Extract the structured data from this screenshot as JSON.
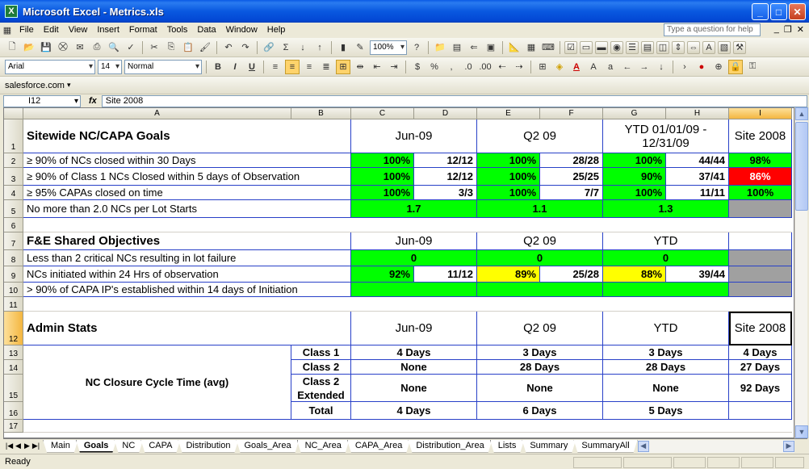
{
  "window": {
    "title": "Microsoft Excel - Metrics.xls",
    "app_glyph": "X"
  },
  "menu": [
    "File",
    "Edit",
    "View",
    "Insert",
    "Format",
    "Tools",
    "Data",
    "Window",
    "Help"
  ],
  "help_placeholder": "Type a question for help",
  "toolbar": {
    "zoom": "100%",
    "font": "Arial",
    "size": "14",
    "style": "Normal",
    "salesforce": "salesforce.com"
  },
  "formula_bar": {
    "name_box": "I12",
    "fx": "fx",
    "content": "Site 2008"
  },
  "columns": [
    "A",
    "B",
    "C",
    "D",
    "E",
    "F",
    "G",
    "H",
    "I"
  ],
  "rows": [
    "1",
    "2",
    "3",
    "4",
    "5",
    "6",
    "7",
    "8",
    "9",
    "10",
    "11",
    "12",
    "13",
    "14",
    "15",
    "16",
    "17"
  ],
  "sheet": {
    "sitewide": {
      "title": "Sitewide NC/CAPA Goals",
      "periods": [
        "Jun-09",
        "Q2 09",
        "YTD 01/01/09 - 12/31/09",
        "Site 2008"
      ],
      "rows": [
        {
          "label": "≥ 90% of NCs closed within 30 Days",
          "c": "100%",
          "d": "12/12",
          "e": "100%",
          "f": "28/28",
          "g": "100%",
          "h": "44/44",
          "i": "98%"
        },
        {
          "label": "≥ 90% of Class 1 NCs Closed within 5 days of Observation",
          "c": "100%",
          "d": "12/12",
          "e": "100%",
          "f": "25/25",
          "g": "90%",
          "h": "37/41",
          "i": "86%"
        },
        {
          "label": "≥ 95% CAPAs closed on time",
          "c": "100%",
          "d": "3/3",
          "e": "100%",
          "f": "7/7",
          "g": "100%",
          "h": "11/11",
          "i": "100%"
        },
        {
          "label": "No more than 2.0 NCs per Lot Starts",
          "jun": "1.7",
          "q2": "1.1",
          "ytd": "1.3"
        }
      ]
    },
    "fe": {
      "title": "F&E Shared Objectives",
      "periods": [
        "Jun-09",
        "Q2 09",
        "YTD"
      ],
      "rows": [
        {
          "label": "Less than 2 critical NCs resulting in lot failure",
          "jun": "0",
          "q2": "0",
          "ytd": "0"
        },
        {
          "label": "NCs initiated within 24 Hrs of observation",
          "c": "92%",
          "d": "11/12",
          "e": "89%",
          "f": "25/28",
          "g": "88%",
          "h": "39/44"
        },
        {
          "label": "> 90% of CAPA IP's established within 14 days of Initiation"
        }
      ]
    },
    "admin": {
      "title": "Admin Stats",
      "periods": [
        "Jun-09",
        "Q2 09",
        "YTD",
        "Site 2008"
      ],
      "group_label": "NC Closure Cycle Time (avg)",
      "rows": [
        {
          "cls": "Class 1",
          "jun": "4 Days",
          "q2": "3 Days",
          "ytd": "3 Days",
          "site": "4 Days"
        },
        {
          "cls": "Class 2",
          "jun": "None",
          "q2": "28 Days",
          "ytd": "28 Days",
          "site": "27 Days"
        },
        {
          "cls": "Class 2 Extended",
          "jun": "None",
          "q2": "None",
          "ytd": "None",
          "site": "92 Days"
        },
        {
          "cls": "Total",
          "jun": "4 Days",
          "q2": "6 Days",
          "ytd": "5 Days",
          "site": ""
        }
      ]
    }
  },
  "tabs": [
    "Main",
    "Goals",
    "NC",
    "CAPA",
    "Distribution",
    "Goals_Area",
    "NC_Area",
    "CAPA_Area",
    "Distribution_Area",
    "Lists",
    "Summary",
    "SummaryAll"
  ],
  "active_tab": "Goals",
  "status": "Ready",
  "colors": {
    "green": "#00ff00",
    "yellow": "#ffff00",
    "red": "#ff0000",
    "gray": "#a0a0a0",
    "border": "#2840c8"
  }
}
